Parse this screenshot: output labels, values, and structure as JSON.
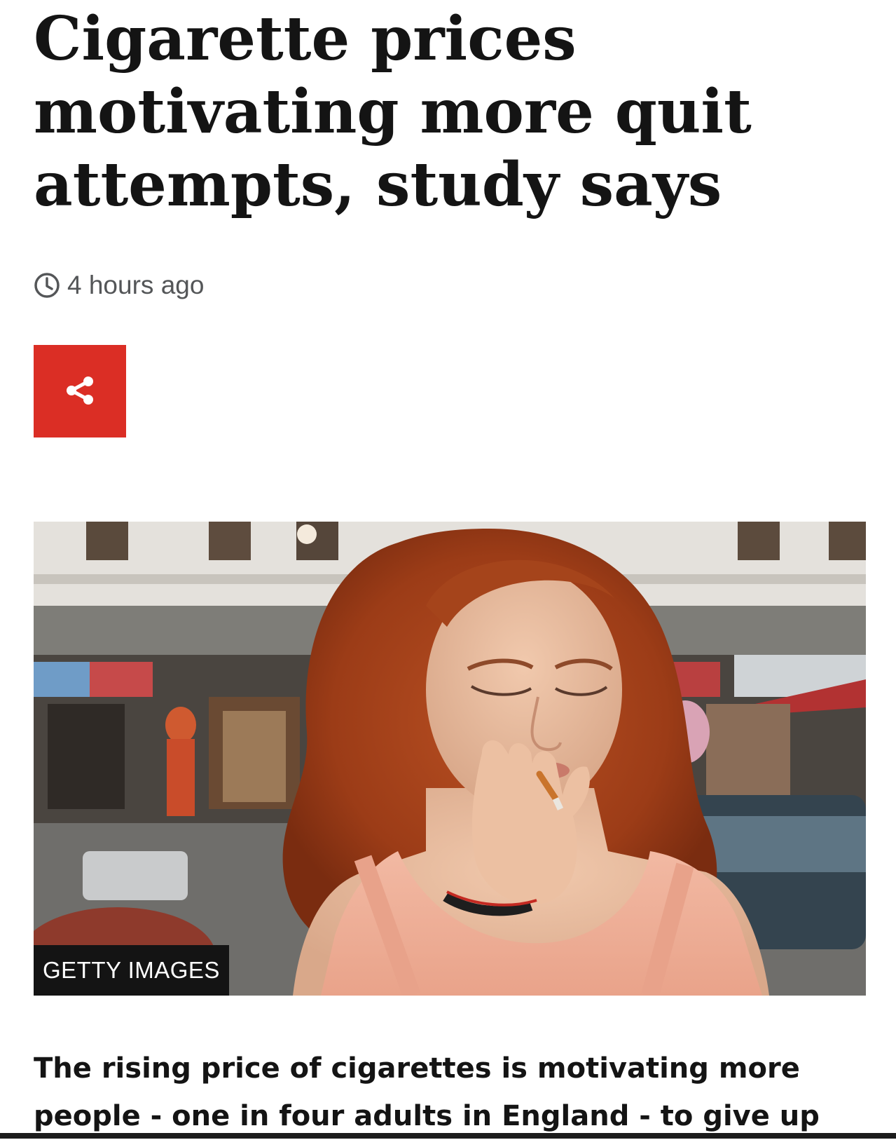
{
  "article": {
    "headline": "Cigarette prices motivating more quit attempts, study says",
    "timestamp": "4 hours ago",
    "share_icon": "share-icon",
    "clock_icon": "clock-icon",
    "image": {
      "credit": "GETTY IMAGES"
    },
    "summary": "The rising price of cigarettes is motivating more people - one in four adults in England - to give up"
  },
  "colors": {
    "share_button": "#db2e25",
    "headline": "#141414",
    "timestamp": "#545658",
    "credit_badge": "#141414"
  }
}
